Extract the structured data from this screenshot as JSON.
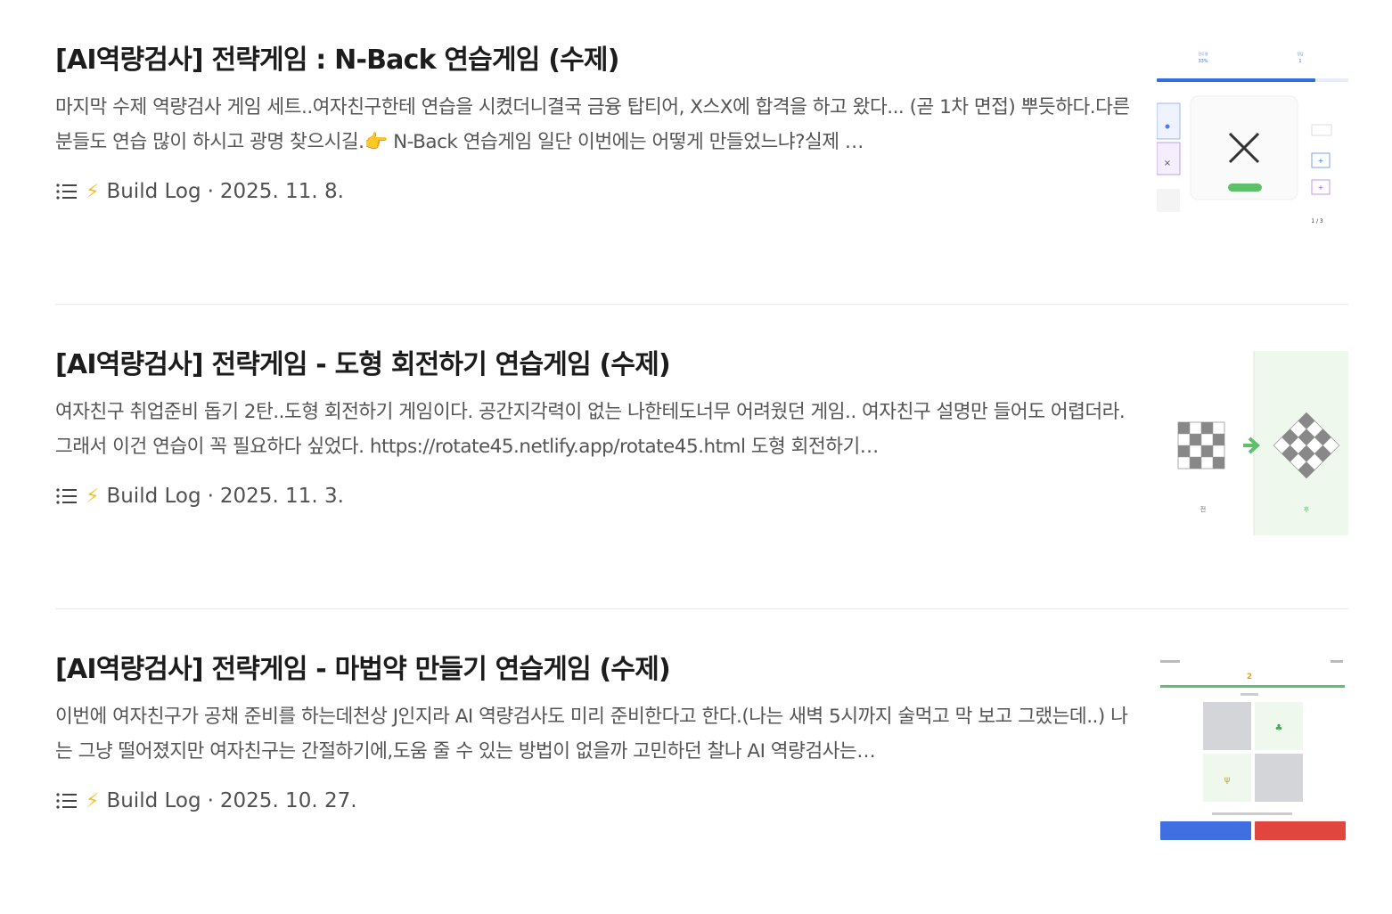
{
  "posts": [
    {
      "title": "[AI역량검사] 전략게임 : N-Back 연습게임 (수제)",
      "excerpt": "마지막 수제 역량검사 게임 세트..여자친구한테 연습을 시켰더니결국 금융 탑티어, X스X에 합격을 하고 왔다... (곧 1차 면접) 뿌듯하다.다른 분들도 연습 많이 하시고 광명 찾으시길.👉 N-Back 연습게임 일단 이번에는 어떻게 만들었느냐?실제 …",
      "category": "Build Log",
      "separator": "·",
      "date": "2025. 11. 8.",
      "icons": [
        "list-icon",
        "lightning-icon"
      ],
      "thumbnail": {
        "progress_label": "진도율",
        "progress_value": "33%",
        "count_label": "정답",
        "count_value": "1",
        "score": "1 / 3"
      }
    },
    {
      "title": "[AI역량검사] 전략게임 - 도형 회전하기 연습게임 (수제)",
      "excerpt": "여자친구 취업준비 돕기 2탄..도형 회전하기 게임이다. 공간지각력이 없는 나한테도너무 어려웠던 게임.. 여자친구 설명만 들어도 어렵더라.그래서 이건 연습이 꼭 필요하다 싶었다. https://rotate45.netlify.app/rotate45.html 도형 회전하기…",
      "category": "Build Log",
      "separator": "·",
      "date": "2025. 11. 3.",
      "icons": [
        "list-icon",
        "lightning-icon"
      ],
      "thumbnail": {
        "before_label": "전",
        "after_label": "후"
      }
    },
    {
      "title": "[AI역량검사] 전략게임 - 마법약 만들기 연습게임 (수제)",
      "excerpt": "이번에 여자친구가 공채 준비를 하는데천상 J인지라 AI 역량검사도 미리 준비한다고 한다.(나는 새벽 5시까지 술먹고 막 보고 그랬는데..) 나는 그냥 떨어졌지만 여자친구는 간절하기에,도움 줄 수 있는 방법이 없을까 고민하던 찰나 AI 역량검사는…",
      "category": "Build Log",
      "separator": "·",
      "date": "2025. 10. 27.",
      "icons": [
        "list-icon",
        "lightning-icon"
      ],
      "thumbnail": {
        "round": "2"
      }
    }
  ],
  "colors": {
    "title": "#1c1c1c",
    "excerpt": "#555555",
    "meta": "#505050",
    "divider": "#e8e8e8",
    "bolt": "#f2c12e",
    "blue": "#2f6fe0",
    "green": "#5cc16a",
    "red": "#e0463e"
  }
}
